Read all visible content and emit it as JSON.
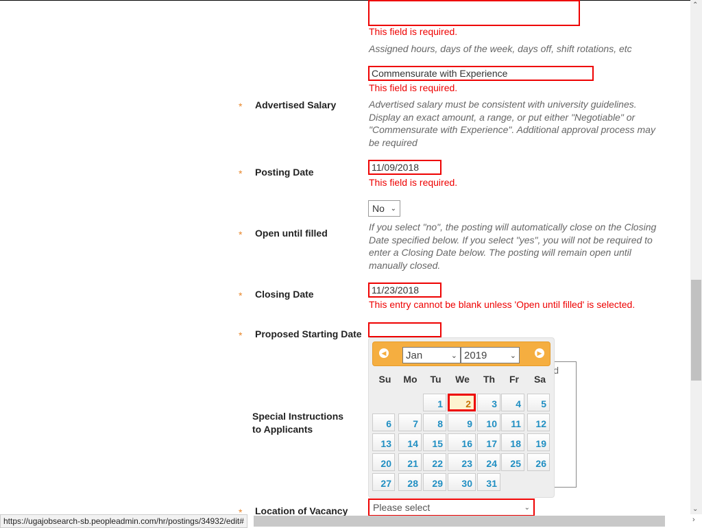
{
  "work_schedule": {
    "error": "This field is required.",
    "help": "Assigned hours, days of the week, days off, shift rotations, etc"
  },
  "advertised_salary": {
    "label": "Advertised Salary",
    "value": "Commensurate with Experience",
    "error": "This field is required.",
    "help": "Advertised salary must be consistent with university guidelines. Display an exact amount, a range, or put either \"Negotiable\" or \"Commensurate with Experience\". Additional approval process may be required"
  },
  "posting_date": {
    "label": "Posting Date",
    "value": "11/09/2018",
    "error": "This field is required."
  },
  "open_until_filled": {
    "label": "Open until filled",
    "value": "No",
    "help": "If you select \"no\", the posting will automatically close on the Closing Date specified below. If you select \"yes\", you will not be required to enter a Closing Date below. The posting will remain open until manually closed."
  },
  "closing_date": {
    "label": "Closing Date",
    "value": "11/23/2018",
    "error": "This entry cannot be blank unless 'Open until filled' is selected."
  },
  "proposed_start": {
    "label": "Proposed Starting Date",
    "value": ""
  },
  "special_instructions": {
    "label": "Special Instructions to Applicants",
    "partial_text": "d"
  },
  "location": {
    "label": "Location of Vacancy",
    "value": "Please select"
  },
  "required_marker": "*",
  "datepicker": {
    "month": "Jan",
    "year": "2019",
    "weekdays": [
      "Su",
      "Mo",
      "Tu",
      "We",
      "Th",
      "Fr",
      "Sa"
    ],
    "first_weekday": 2,
    "days": 31,
    "highlighted_day": 2,
    "accent": "#f5ae40"
  },
  "status_url": "https://ugajobsearch-sb.peopleadmin.com/hr/postings/34932/edit#"
}
